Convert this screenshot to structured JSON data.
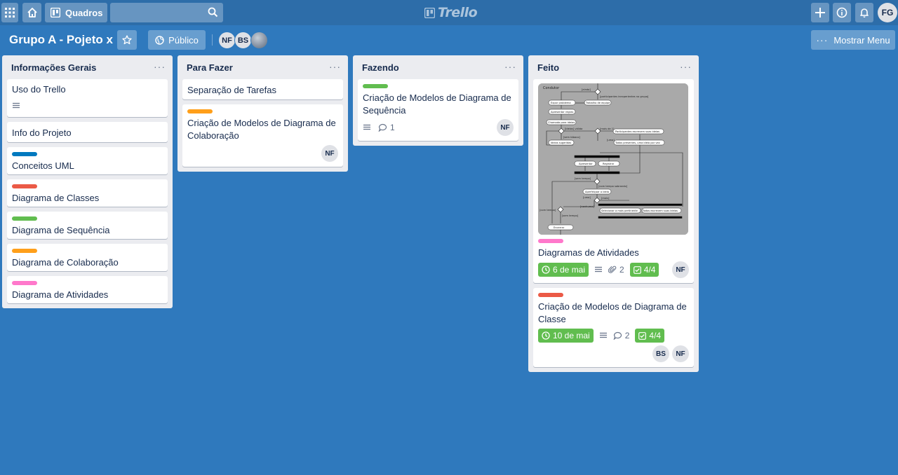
{
  "header": {
    "boards_label": "Quadros",
    "search_placeholder": "",
    "logo_text": "Trello",
    "user_initials": "FG"
  },
  "board": {
    "title": "Grupo A - Pojeto x",
    "visibility": "Público",
    "members": [
      "NF",
      "BS"
    ],
    "show_menu_label": "Mostrar Menu"
  },
  "lists": [
    {
      "title": "Informações Gerais",
      "cards": [
        {
          "title": "Uso do Trello",
          "has_description": true
        },
        {
          "title": "Info do Projeto"
        },
        {
          "title": "Conceitos UML",
          "label_color": "#0079bf"
        },
        {
          "title": "Diagrama de Classes",
          "label_color": "#eb5a46"
        },
        {
          "title": "Diagrama de Sequência",
          "label_color": "#61bd4f"
        },
        {
          "title": "Diagrama de Colaboração",
          "label_color": "#ff9f1a"
        },
        {
          "title": "Diagrama de Atividades",
          "label_color": "#ff78cb"
        }
      ]
    },
    {
      "title": "Para Fazer",
      "cards": [
        {
          "title": "Separação de Tarefas"
        },
        {
          "title": "Criação de Modelos de Diagrama de Colaboração",
          "label_color": "#ff9f1a",
          "members": [
            "NF"
          ]
        }
      ]
    },
    {
      "title": "Fazendo",
      "cards": [
        {
          "title": "Criação de Modelos de Diagrama de Sequência",
          "label_color": "#61bd4f",
          "comments": "1",
          "members": [
            "NF"
          ]
        }
      ]
    },
    {
      "title": "Feito",
      "cards": [
        {
          "title": "Diagramas de Atividades",
          "label_color": "#ff78cb",
          "due": "6 de mai",
          "attachments": "2",
          "checklist": "4/4",
          "members": [
            "NF"
          ],
          "cover": {
            "swimlane": "Condutor",
            "guards": [
              "[ainda]",
              "[participantes inexperientes no grupo]",
              "[ideias] válida",
              "[mais de 1]",
              "[sem tábaco]",
              "[uma]",
              "[sem tempo]",
              "[com tempo sobrando]",
              "[uma]",
              "[mais]",
              "[nenhuma]",
              "[com tempo]",
              "[sem tempo]"
            ],
            "actions": [
              "Expor problema",
              "Trabalho de equipe",
              "Apresentar regras",
              "Chamada para ideias",
              "Participantes escrevem suas ideias",
              "Ideias sugeridas",
              "Todos presentes, uma ideia por vez",
              "Apresentar",
              "Registrar",
              "Aperfeiçoar a ideia",
              "Selecionar a mais pertinente",
              "Todos escrevem suas ideias",
              "Encerrar"
            ]
          }
        },
        {
          "title": "Criação de Modelos de Diagrama de Classe",
          "label_color": "#eb5a46",
          "due": "10 de mai",
          "comments": "2",
          "checklist": "4/4",
          "members": [
            "BS",
            "NF"
          ]
        }
      ]
    }
  ]
}
